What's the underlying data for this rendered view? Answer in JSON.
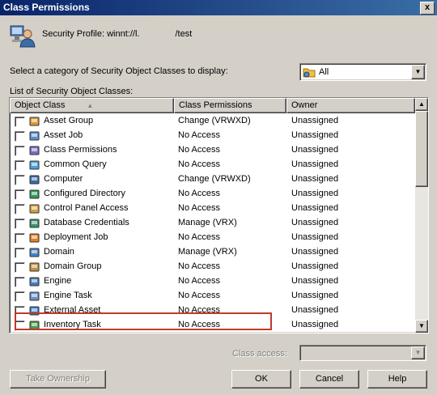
{
  "window": {
    "title": "Class Permissions",
    "close_label": "x"
  },
  "profile": {
    "label": "Security Profile:",
    "value": "winnt://l.",
    "suffix": "/test"
  },
  "category": {
    "label": "Select a category of Security Object Classes to display:",
    "selected": "All"
  },
  "list": {
    "label": "List of Security Object Classes:",
    "columns": [
      "Object Class",
      "Class Permissions",
      "Owner"
    ],
    "rows": [
      {
        "name": "Asset Group",
        "perm": "Change (VRWXD)",
        "owner": "Unassigned",
        "icon": "asset-group-icon"
      },
      {
        "name": "Asset Job",
        "perm": "No Access",
        "owner": "Unassigned",
        "icon": "asset-job-icon"
      },
      {
        "name": "Class Permissions",
        "perm": "No Access",
        "owner": "Unassigned",
        "icon": "class-permissions-icon"
      },
      {
        "name": "Common Query",
        "perm": "No Access",
        "owner": "Unassigned",
        "icon": "common-query-icon"
      },
      {
        "name": "Computer",
        "perm": "Change (VRWXD)",
        "owner": "Unassigned",
        "icon": "computer-icon"
      },
      {
        "name": "Configured Directory",
        "perm": "No Access",
        "owner": "Unassigned",
        "icon": "configured-directory-icon"
      },
      {
        "name": "Control Panel Access",
        "perm": "No Access",
        "owner": "Unassigned",
        "icon": "control-panel-icon"
      },
      {
        "name": "Database Credentials",
        "perm": "Manage (VRX)",
        "owner": "Unassigned",
        "icon": "database-credentials-icon"
      },
      {
        "name": "Deployment Job",
        "perm": "No Access",
        "owner": "Unassigned",
        "icon": "deployment-job-icon"
      },
      {
        "name": "Domain",
        "perm": "Manage (VRX)",
        "owner": "Unassigned",
        "icon": "domain-icon"
      },
      {
        "name": "Domain Group",
        "perm": "No Access",
        "owner": "Unassigned",
        "icon": "domain-group-icon"
      },
      {
        "name": "Engine",
        "perm": "No Access",
        "owner": "Unassigned",
        "icon": "engine-icon"
      },
      {
        "name": "Engine Task",
        "perm": "No Access",
        "owner": "Unassigned",
        "icon": "engine-task-icon"
      },
      {
        "name": "External Asset",
        "perm": "No Access",
        "owner": "Unassigned",
        "icon": "external-asset-icon"
      },
      {
        "name": "Inventory Task",
        "perm": "No Access",
        "owner": "Unassigned",
        "icon": "inventory-task-icon"
      }
    ]
  },
  "class_access": {
    "label": "Class access:",
    "value": ""
  },
  "buttons": {
    "take_ownership": "Take Ownership",
    "ok": "OK",
    "cancel": "Cancel",
    "help": "Help"
  }
}
